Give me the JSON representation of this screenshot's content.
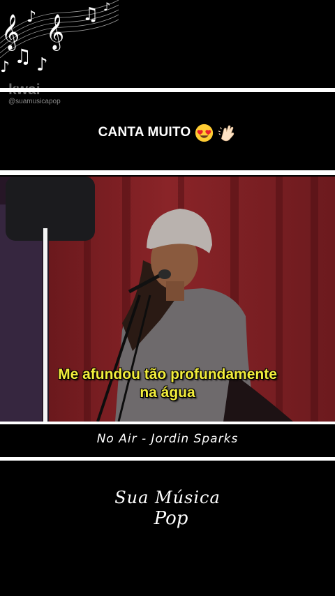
{
  "decoration": {
    "icon": "music-notes-icon"
  },
  "watermark": {
    "logo": "kwai",
    "handle": "@suamusicapop"
  },
  "caption": {
    "text": "CANTA MUITO",
    "emojis": [
      "heart-eyes-face-icon",
      "clapping-hands-icon"
    ]
  },
  "video": {
    "subtitle_line1": "Me afundou tão profundamente",
    "subtitle_line2": "na água",
    "subtitle_color": "#f3ee3c",
    "curtain_color": "#7d1d20"
  },
  "song": {
    "title": "No Air - Jordin Sparks"
  },
  "brand": {
    "line1": "Sua Música",
    "line2": "Pop"
  }
}
